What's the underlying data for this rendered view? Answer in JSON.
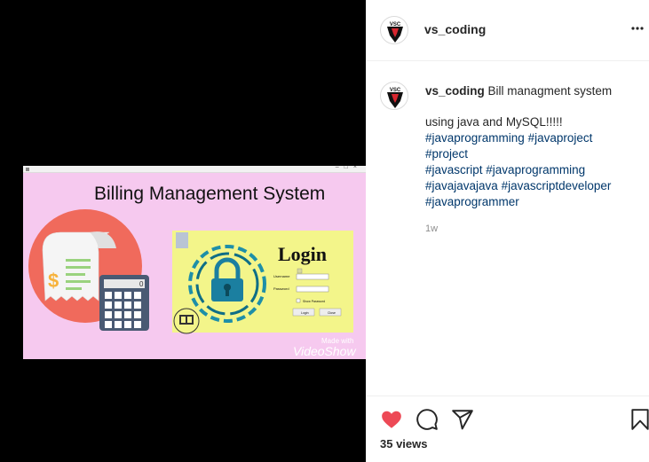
{
  "post_image": {
    "title": "Billing Management System",
    "login_title": "Login",
    "username_label": "Username",
    "password_label": "Password",
    "show_password_label": "Show Password",
    "login_button": "Login",
    "close_button": "Close",
    "watermark_line1": "Made with",
    "watermark_line2": "VideoShow",
    "calc_display": "0",
    "dollar": "$"
  },
  "header": {
    "username": "vs_coding",
    "avatar_text": "VSC"
  },
  "caption": {
    "username": "vs_coding",
    "line1": "Bill managment system",
    "line2": "using java and MySQL!!!!!",
    "hashtags": [
      "#javaprogramming",
      "#javaproject",
      "#project",
      "#javascript",
      "#javaprogramming",
      "#javajavajava",
      "#javascriptdeveloper",
      "#javaprogrammer"
    ],
    "time_ago": "1w"
  },
  "stats": {
    "views": "35 views"
  },
  "colors": {
    "like_red": "#ed4956",
    "hashtag_blue": "#00376b",
    "image_bg": "#f6c9ef",
    "login_panel": "#f3f58a"
  }
}
